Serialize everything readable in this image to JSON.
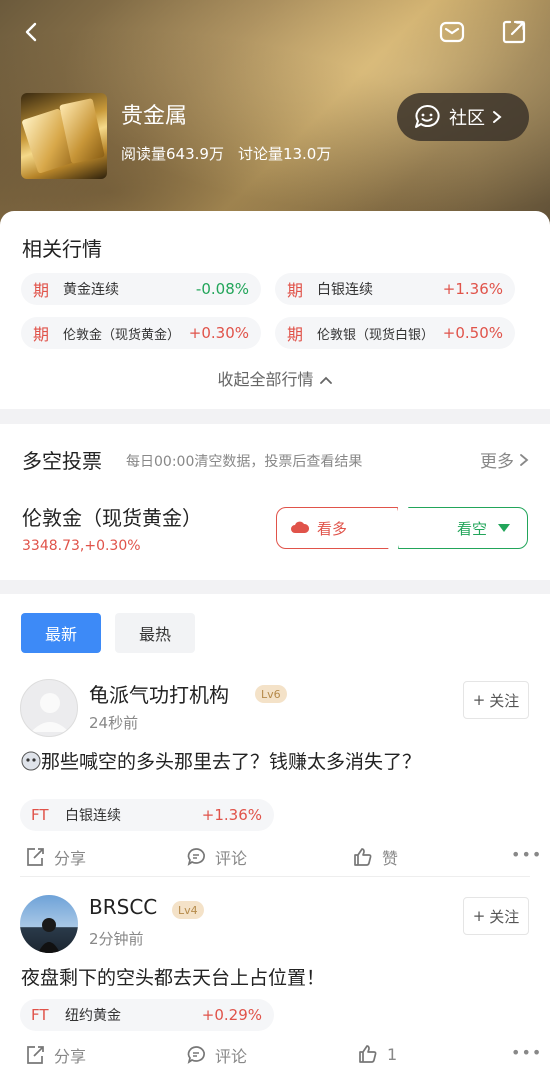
{
  "topic": {
    "title": "贵金属",
    "reads": "阅读量643.9万",
    "discussions": "讨论量13.0万",
    "community_label": "社区"
  },
  "markets": {
    "title": "相关行情",
    "items": [
      {
        "tag": "期",
        "name": "黄金连续",
        "change": "-0.08%",
        "dir": "down"
      },
      {
        "tag": "期",
        "name": "白银连续",
        "change": "+1.36%",
        "dir": "up"
      },
      {
        "tag": "期",
        "name": "伦敦金（现货黄金）",
        "change": "+0.30%",
        "dir": "up"
      },
      {
        "tag": "期",
        "name": "伦敦银（现货白银）",
        "change": "+0.50%",
        "dir": "up"
      }
    ],
    "collapse_label": "收起全部行情"
  },
  "vote": {
    "title": "多空投票",
    "subtitle": "每日00:00清空数据，投票后查看结果",
    "more_label": "更多",
    "asset_name": "伦敦金（现货黄金）",
    "asset_price": "3348.73,+0.30%",
    "bull_label": "看多",
    "bear_label": "看空"
  },
  "feed": {
    "tabs": [
      {
        "label": "最新"
      },
      {
        "label": "最热"
      }
    ],
    "posts": [
      {
        "user": "龟派气功打机构",
        "level": "Lv6",
        "time": "24秒前",
        "follow_label": "关注",
        "text": "那些喊空的多头那里去了？钱赚太多消失了？",
        "chip": {
          "tag": "FT",
          "name": "白银连续",
          "change": "+1.36%"
        },
        "share_label": "分享",
        "comment_label": "评论",
        "like_label": "赞"
      },
      {
        "user": "BRSCC",
        "level": "Lv4",
        "time": "2分钟前",
        "follow_label": "关注",
        "text": "夜盘剩下的空头都去天台上占位置！",
        "chip": {
          "tag": "FT",
          "name": "纽约黄金",
          "change": "+0.29%"
        },
        "share_label": "分享",
        "comment_label": "评论",
        "like_label": "1"
      }
    ]
  },
  "colors": {
    "up": "#e0534a",
    "down": "#22a55a",
    "accent": "#3d8af7"
  }
}
